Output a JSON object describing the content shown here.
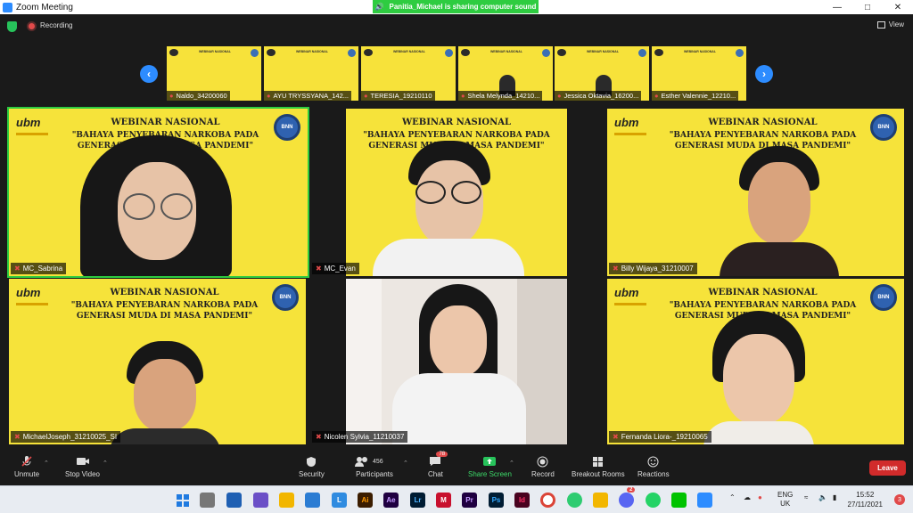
{
  "window": {
    "title": "Zoom Meeting",
    "share_banner": "Panitia_Michael is sharing computer sound"
  },
  "topbar": {
    "recording_label": "Recording",
    "view_label": "View"
  },
  "webinar": {
    "line1": "WEBINAR NASIONAL",
    "line2": "\"BAHAYA PENYEBARAN NARKOBA PADA GENERASI MUDA DI MASA PANDEMI\"",
    "logo_text": "ubm",
    "seal_text": "BNN"
  },
  "thumbnails": [
    {
      "name": "Naldo_34200060"
    },
    {
      "name": "AYU TRYSSYANA_142..."
    },
    {
      "name": "TERESIA_19210110"
    },
    {
      "name": "Shela Melynda_14210..."
    },
    {
      "name": "Jessica Oktavia_16200..."
    },
    {
      "name": "Esther Valennie_12210..."
    }
  ],
  "tiles": [
    {
      "name": "MC_Sabrina"
    },
    {
      "name": "MC_Evan"
    },
    {
      "name": "Billy Wijaya_31210007"
    },
    {
      "name": "MichaelJoseph_31210025_SI"
    },
    {
      "name": "Nicolen Sylvia_11210037"
    },
    {
      "name": "Fernanda Liora-_19210065"
    }
  ],
  "toolbar": {
    "unmute": "Unmute",
    "stop_video": "Stop Video",
    "security": "Security",
    "participants": "Participants",
    "participants_count": "456",
    "chat": "Chat",
    "chat_badge": "78",
    "share_screen": "Share Screen",
    "record": "Record",
    "breakout": "Breakout Rooms",
    "reactions": "Reactions",
    "leave": "Leave"
  },
  "taskbar": {
    "lang1": "ENG",
    "lang2": "UK",
    "time": "15:52",
    "date": "27/11/2021",
    "notif_count": "3",
    "discord_badge": "2"
  },
  "colors": {
    "zoom_blue": "#2d8cff",
    "banner_green": "#2ecc40",
    "leave_red": "#d12b2b",
    "webinar_yellow": "#f6e33a"
  }
}
